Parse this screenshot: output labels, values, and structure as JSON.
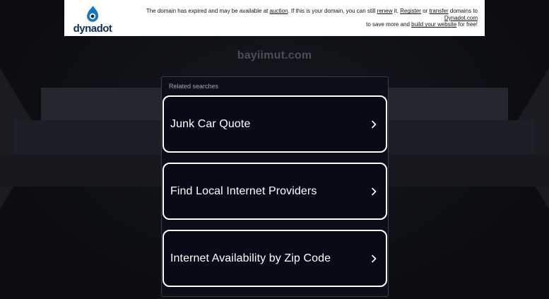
{
  "banner": {
    "logo_text": "dynadot",
    "line1_prefix": "The domain has expired and may be available at ",
    "line1_link_auction": "auction",
    "line1_mid": ". If this is your domain, you can still ",
    "line1_link_renew": "renew",
    "line1_mid2": " it. ",
    "line1_link_register": "Register",
    "line1_or": " or ",
    "line1_link_transfer": "transfer",
    "line1_domains_to": " domains to ",
    "line1_link_dynadot": "Dynadot.com",
    "line2_prefix": "to save more and ",
    "line2_link_build": "build your website",
    "line2_suffix": " for free!"
  },
  "domain_name": "bayiimut.com",
  "related": {
    "heading": "Related searches",
    "items": [
      {
        "label": "Junk Car Quote"
      },
      {
        "label": "Find Local Internet Providers"
      },
      {
        "label": "Internet Availability by Zip Code"
      }
    ]
  },
  "colors": {
    "background": "#0d0f13",
    "panel": "#0c0f1a",
    "item_border": "#ffffff",
    "logo_blue": "#0f2f5c",
    "domain_text": "#4a4e57"
  },
  "icons": {
    "logo": "dynadot-logo-icon",
    "chevron": "chevron-right-icon"
  }
}
